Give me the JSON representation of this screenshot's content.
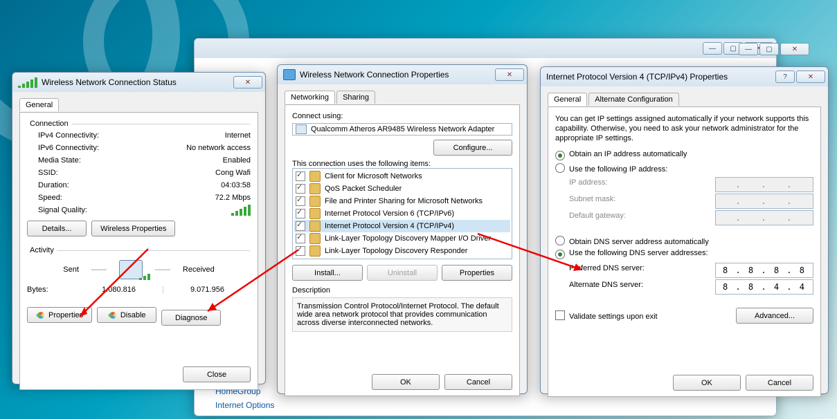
{
  "bg_links": {
    "homegroup": "HomeGroup",
    "internet": "Internet Options"
  },
  "top_winbuttons": {
    "min": "—",
    "max": "▢",
    "close": "✕"
  },
  "win1": {
    "title": "Wireless Network Connection Status",
    "tabs": {
      "general": "General"
    },
    "conn_hdr": "Connection",
    "rows": {
      "ipv4": {
        "l": "IPv4 Connectivity:",
        "v": "Internet"
      },
      "ipv6": {
        "l": "IPv6 Connectivity:",
        "v": "No network access"
      },
      "media": {
        "l": "Media State:",
        "v": "Enabled"
      },
      "ssid": {
        "l": "SSID:",
        "v": "Cong Wafi"
      },
      "dur": {
        "l": "Duration:",
        "v": "04:03:58"
      },
      "speed": {
        "l": "Speed:",
        "v": "72.2 Mbps"
      },
      "sigq": {
        "l": "Signal Quality:"
      }
    },
    "btn_details": "Details...",
    "btn_wprops": "Wireless Properties",
    "act_hdr": "Activity",
    "sent": "Sent",
    "recv": "Received",
    "bytes_l": "Bytes:",
    "bytes_sent": "1.080.816",
    "bytes_recv": "9.071.956",
    "btn_props": "Properties",
    "btn_disable": "Disable",
    "btn_diag": "Diagnose",
    "btn_close": "Close"
  },
  "win2": {
    "title": "Wireless Network Connection Properties",
    "tabs": {
      "net": "Networking",
      "share": "Sharing"
    },
    "connect_using": "Connect using:",
    "adapter": "Qualcomm Atheros AR9485 Wireless Network Adapter",
    "btn_cfg": "Configure...",
    "items_hdr": "This connection uses the following items:",
    "items": [
      {
        "name": "Client for Microsoft Networks",
        "icon": "client-icon"
      },
      {
        "name": "QoS Packet Scheduler",
        "icon": "qos-icon"
      },
      {
        "name": "File and Printer Sharing for Microsoft Networks",
        "icon": "fps-icon"
      },
      {
        "name": "Internet Protocol Version 6 (TCP/IPv6)",
        "icon": "protocol-icon"
      },
      {
        "name": "Internet Protocol Version 4 (TCP/IPv4)",
        "icon": "protocol-icon",
        "sel": true
      },
      {
        "name": "Link-Layer Topology Discovery Mapper I/O Driver",
        "icon": "lltd-icon"
      },
      {
        "name": "Link-Layer Topology Discovery Responder",
        "icon": "lltd-icon"
      }
    ],
    "btn_install": "Install...",
    "btn_uninstall": "Uninstall",
    "btn_props": "Properties",
    "desc_hdr": "Description",
    "desc": "Transmission Control Protocol/Internet Protocol. The default wide area network protocol that provides communication across diverse interconnected networks.",
    "btn_ok": "OK",
    "btn_cancel": "Cancel"
  },
  "win3": {
    "title": "Internet Protocol Version 4 (TCP/IPv4) Properties",
    "tabs": {
      "gen": "General",
      "alt": "Alternate Configuration"
    },
    "intro": "You can get IP settings assigned automatically if your network supports this capability. Otherwise, you need to ask your network administrator for the appropriate IP settings.",
    "r_ip_auto": "Obtain an IP address automatically",
    "r_ip_man": "Use the following IP address:",
    "l_ip": "IP address:",
    "l_mask": "Subnet mask:",
    "l_gw": "Default gateway:",
    "r_dns_auto": "Obtain DNS server address automatically",
    "r_dns_man": "Use the following DNS server addresses:",
    "l_pdns": "Preferred DNS server:",
    "l_adns": "Alternate DNS server:",
    "v_pdns": "8 . 8 . 8 . 8",
    "v_adns": "8 . 8 . 4 . 4",
    "validate": "Validate settings upon exit",
    "btn_adv": "Advanced...",
    "btn_ok": "OK",
    "btn_cancel": "Cancel"
  }
}
